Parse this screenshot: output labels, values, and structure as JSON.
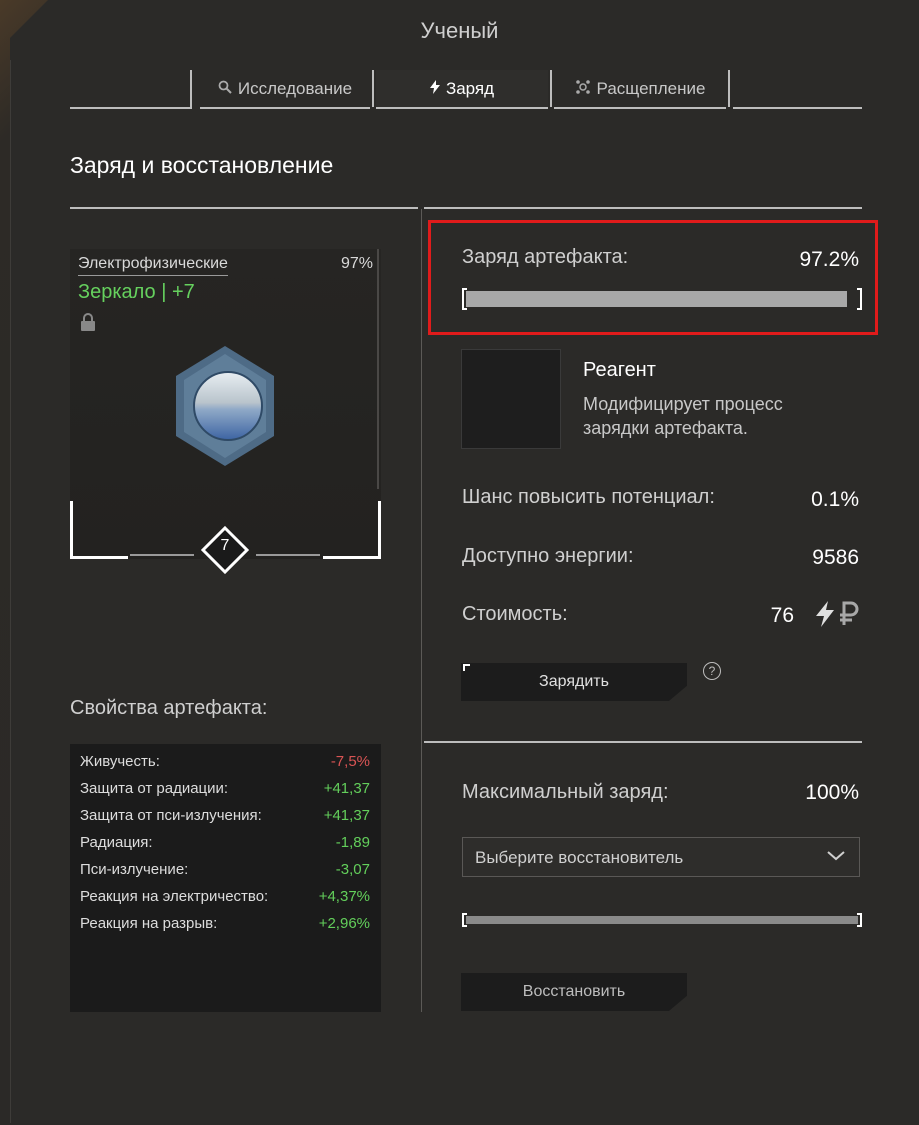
{
  "window": {
    "title": "Ученый"
  },
  "tabs": [
    {
      "label": "",
      "icon": ""
    },
    {
      "label": "Исследование",
      "icon": "search-icon"
    },
    {
      "label": "Заряд",
      "icon": "lightning-icon"
    },
    {
      "label": "Расщепление",
      "icon": "split-icon"
    },
    {
      "label": "",
      "icon": ""
    }
  ],
  "active_tab": "Заряд",
  "section_title": "Заряд и восстановление",
  "artifact": {
    "category": "Электрофизические",
    "percent": "97%",
    "name": "Зеркало | +7",
    "level": "7",
    "locked": true
  },
  "properties": {
    "title": "Свойства артефакта:",
    "rows": [
      {
        "label": "Живучесть:",
        "value": "-7,5%",
        "tone": "neg"
      },
      {
        "label": "Защита от радиации:",
        "value": "+41,37",
        "tone": "pos"
      },
      {
        "label": "Защита от пси-излучения:",
        "value": "+41,37",
        "tone": "pos"
      },
      {
        "label": "Радиация:",
        "value": "-1,89",
        "tone": "pos"
      },
      {
        "label": "Пси-излучение:",
        "value": "-3,07",
        "tone": "pos"
      },
      {
        "label": "Реакция на электричество:",
        "value": "+4,37%",
        "tone": "pos"
      },
      {
        "label": "Реакция на разрыв:",
        "value": "+2,96%",
        "tone": "pos"
      }
    ]
  },
  "charge": {
    "label": "Заряд артефакта:",
    "value": "97.2%",
    "fraction": 0.972
  },
  "reagent": {
    "name": "Реагент",
    "description": "Модифицирует процесс зарядки артефакта."
  },
  "stats": {
    "chance_label": "Шанс повысить потенциал:",
    "chance_value": "0.1%",
    "energy_label": "Доступно энергии:",
    "energy_value": "9586",
    "cost_label": "Стоимость:",
    "cost_value": "76"
  },
  "charge_button": "Зарядить",
  "max_charge": {
    "label": "Максимальный заряд:",
    "value": "100%",
    "fraction": 1.0
  },
  "restorer_select": {
    "placeholder": "Выберите восстановитель"
  },
  "restore_button": "Восстановить",
  "colors": {
    "positive": "#63cf5b",
    "negative": "#d95454",
    "highlight": "#e01b1b",
    "artifact_name": "#66d15e"
  }
}
